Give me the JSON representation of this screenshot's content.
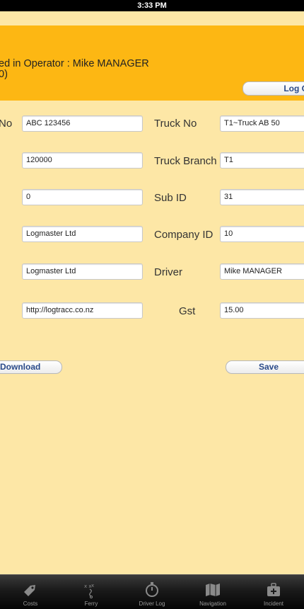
{
  "status_bar": {
    "time": "3:33 PM"
  },
  "header": {
    "operator_line1": "ed in Operator : Mike MANAGER",
    "operator_line2": "0)",
    "logout_label": "Log O"
  },
  "form": {
    "row1": {
      "left_label": "No",
      "left_value": "ABC 123456",
      "right_label": "Truck No",
      "right_value": "T1~Truck AB 50"
    },
    "row2": {
      "left_value": "120000",
      "right_label": "Truck Branch",
      "right_value": "T1"
    },
    "row3": {
      "left_value": "0",
      "right_label": "Sub ID",
      "right_value": "31"
    },
    "row4": {
      "left_value": "Logmaster Ltd",
      "right_label": "Company ID",
      "right_value": "10"
    },
    "row5": {
      "left_value": "Logmaster Ltd",
      "right_label": "Driver",
      "right_value": "Mike MANAGER"
    },
    "row6": {
      "left_value": "http://logtracc.co.nz",
      "right_label": "Gst",
      "right_value": "15.00"
    }
  },
  "actions": {
    "download_label": "Download",
    "save_label": "Save"
  },
  "tabbar": {
    "items": [
      {
        "label": "Costs",
        "icon": "tag-icon"
      },
      {
        "label": "Ferry",
        "icon": "ferry-plan-icon"
      },
      {
        "label": "Driver Log",
        "icon": "stopwatch-icon"
      },
      {
        "label": "Navigation",
        "icon": "map-icon"
      },
      {
        "label": "Incident",
        "icon": "first-aid-kit-icon"
      }
    ]
  }
}
